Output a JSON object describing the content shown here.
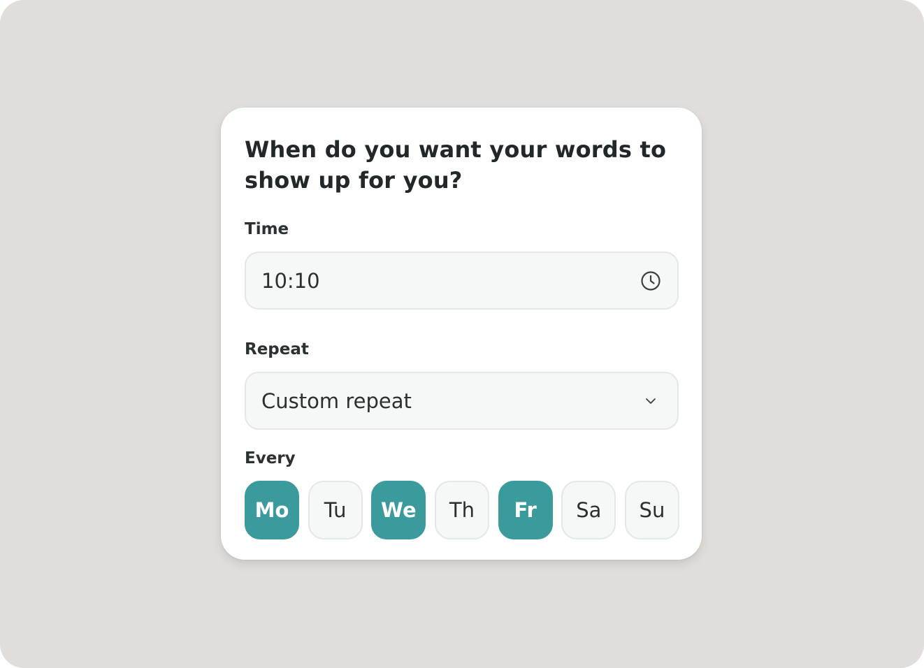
{
  "dialog": {
    "title": "When do you want your words to show up for you?"
  },
  "time": {
    "label": "Time",
    "value": "10:10",
    "icon": "clock-icon"
  },
  "repeat": {
    "label": "Repeat",
    "value": "Custom repeat",
    "icon": "chevron-down-icon"
  },
  "every": {
    "label": "Every",
    "days": [
      {
        "label": "Mo",
        "selected": true
      },
      {
        "label": "Tu",
        "selected": false
      },
      {
        "label": "We",
        "selected": true
      },
      {
        "label": "Th",
        "selected": false
      },
      {
        "label": "Fr",
        "selected": true
      },
      {
        "label": "Sa",
        "selected": false
      },
      {
        "label": "Su",
        "selected": false
      }
    ]
  },
  "colors": {
    "accent": "#3b9a9b",
    "background": "#e0ddda",
    "card": "#ffffff",
    "field_bg": "#f6f8f8",
    "field_border": "#e2e7e8"
  }
}
